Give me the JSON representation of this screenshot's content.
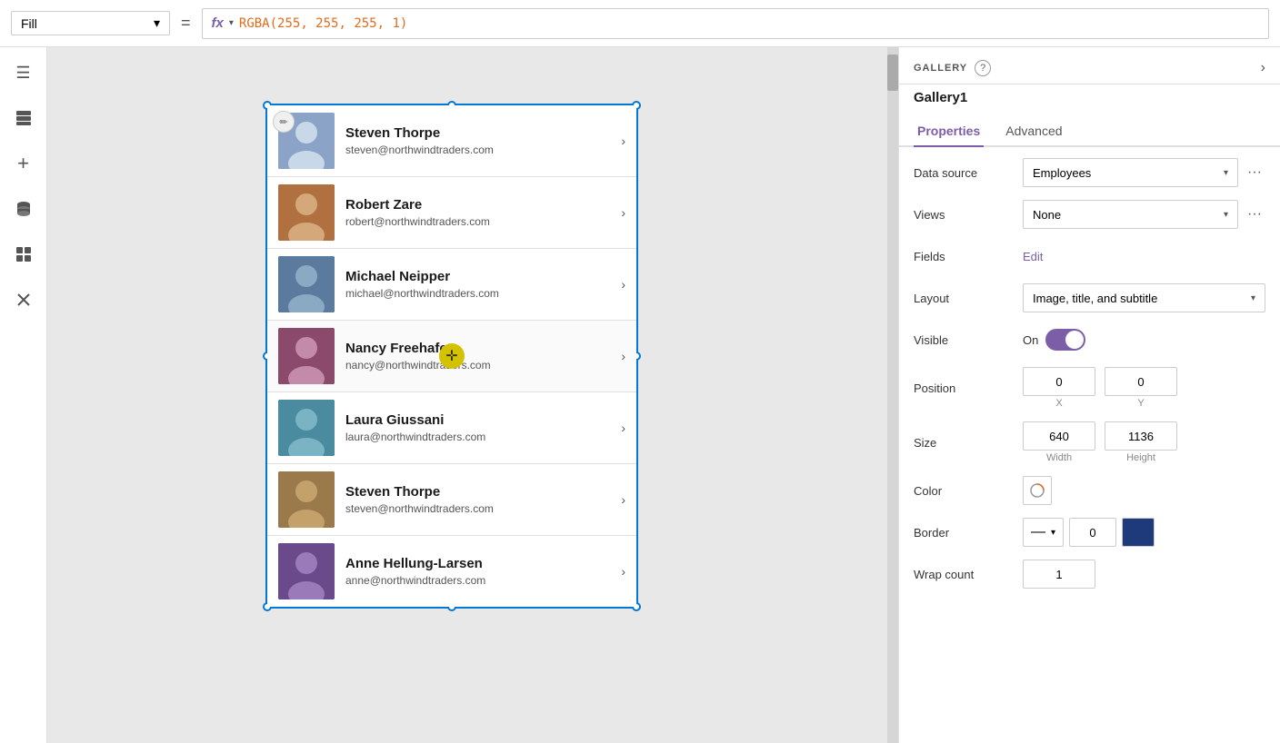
{
  "topbar": {
    "fill_label": "Fill",
    "fill_chevron": "▾",
    "equals": "=",
    "fx_icon": "fx",
    "fx_chevron": "▾",
    "formula": "RGBA(255, 255, 255, 1)"
  },
  "sidebar": {
    "icons": [
      {
        "name": "hamburger-icon",
        "glyph": "☰"
      },
      {
        "name": "layers-icon",
        "glyph": "⊞"
      },
      {
        "name": "add-icon",
        "glyph": "+"
      },
      {
        "name": "database-icon",
        "glyph": "⊙"
      },
      {
        "name": "components-icon",
        "glyph": "⊟"
      },
      {
        "name": "tools-icon",
        "glyph": "✂"
      }
    ]
  },
  "gallery": {
    "items": [
      {
        "name": "Steven Thorpe",
        "email": "steven@northwindtraders.com",
        "avatar_class": "avatar-1"
      },
      {
        "name": "Robert Zare",
        "email": "robert@northwindtraders.com",
        "avatar_class": "avatar-2"
      },
      {
        "name": "Michael Neipper",
        "email": "michael@northwindtraders.com",
        "avatar_class": "avatar-3"
      },
      {
        "name": "Nancy Freehafer",
        "email": "nancy@northwindtraders.com",
        "avatar_class": "avatar-4"
      },
      {
        "name": "Laura Giussani",
        "email": "laura@northwindtraders.com",
        "avatar_class": "avatar-5"
      },
      {
        "name": "Steven Thorpe",
        "email": "steven@northwindtraders.com",
        "avatar_class": "avatar-6"
      },
      {
        "name": "Anne Hellung-Larsen",
        "email": "anne@northwindtraders.com",
        "avatar_class": "avatar-7"
      }
    ]
  },
  "right_panel": {
    "section_title": "GALLERY",
    "help": "?",
    "gallery_name": "Gallery1",
    "tabs": [
      {
        "label": "Properties",
        "active": true
      },
      {
        "label": "Advanced",
        "active": false
      }
    ],
    "properties": {
      "data_source_label": "Data source",
      "data_source_value": "Employees",
      "views_label": "Views",
      "views_value": "None",
      "fields_label": "Fields",
      "fields_edit": "Edit",
      "layout_label": "Layout",
      "layout_value": "Image, title, and subtitle",
      "visible_label": "Visible",
      "visible_on": "On",
      "position_label": "Position",
      "position_x": "0",
      "position_y": "0",
      "position_x_label": "X",
      "position_y_label": "Y",
      "size_label": "Size",
      "size_width": "640",
      "size_height": "1136",
      "size_width_label": "Width",
      "size_height_label": "Height",
      "color_label": "Color",
      "border_label": "Border",
      "border_width": "0",
      "wrap_count_label": "Wrap count",
      "wrap_count_value": "1"
    }
  }
}
